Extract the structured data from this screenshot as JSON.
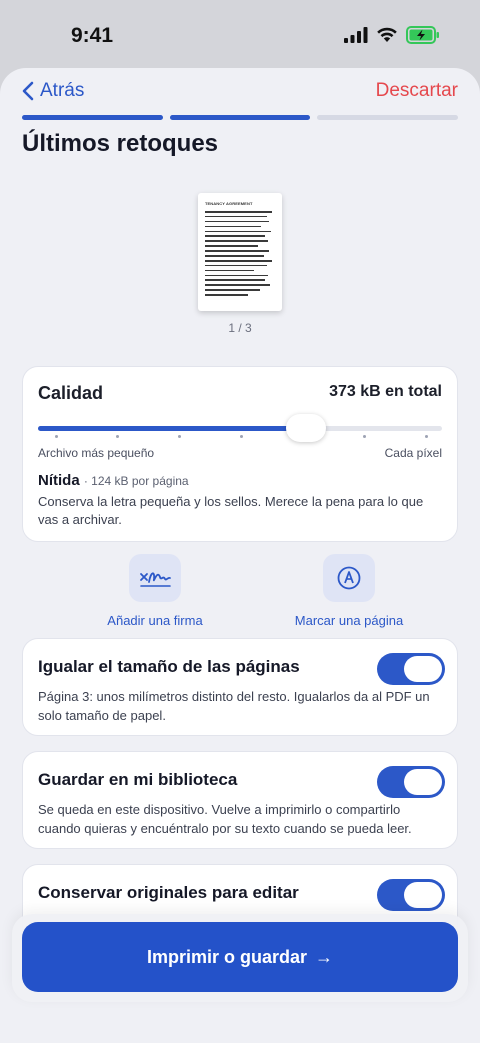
{
  "status": {
    "time": "9:41"
  },
  "nav": {
    "back_label": "Atrás",
    "discard_label": "Descartar"
  },
  "progress": {
    "total_steps": 3,
    "completed_steps": 2
  },
  "title": "Últimos retoques",
  "preview": {
    "doc_heading": "TENANCY AGREEMENT",
    "page_counter": "1 / 3"
  },
  "quality": {
    "label": "Calidad",
    "total_size": "373 kB en total",
    "slider_fraction": 0.66,
    "min_label": "Archivo más pequeño",
    "max_label": "Cada píxel",
    "level_name": "Nítida",
    "level_detail": "· 124 kB por página",
    "description": "Conserva la letra pequeña y los sellos. Merece la pena para lo que vas a archivar."
  },
  "actions": [
    {
      "label": "Añadir una firma",
      "icon": "signature-icon"
    },
    {
      "label": "Marcar una página",
      "icon": "markup-pen-icon"
    }
  ],
  "toggles": [
    {
      "title": "Igualar el tamaño de las páginas",
      "description": "Página 3: unos milímetros distinto del resto. Igualarlos da al PDF un solo tamaño de papel.",
      "on": true
    },
    {
      "title": "Guardar en mi biblioteca",
      "description": "Se queda en este dispositivo. Vuelve a imprimirlo o compartirlo cuando quieras y encuéntralo por su texto cuando se pueda leer.",
      "on": true
    },
    {
      "title": "Conservar originales para editar",
      "description": "",
      "on": true
    }
  ],
  "primary_action": {
    "label": "Imprimir o guardar",
    "arrow": "→"
  },
  "colors": {
    "accent": "#2c58c8",
    "danger": "#e5484d",
    "battery": "#34c759"
  }
}
